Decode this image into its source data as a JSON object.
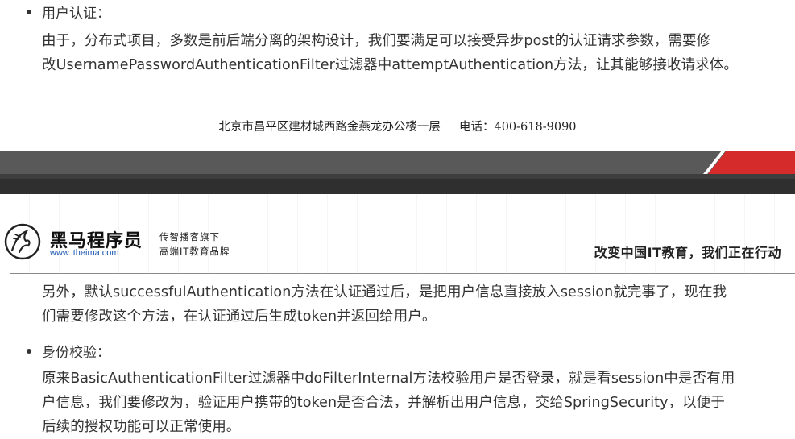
{
  "section_auth": {
    "bullet": "用户认证：",
    "para_line1": "由于，分布式项目，多数是前后端分离的架构设计，我们要满足可以接受异步post的认证请求参数，需要修",
    "para_line2": "改UsernamePasswordAuthenticationFilter过滤器中attemptAuthentication方法，让其能够接收请求体。"
  },
  "footer": {
    "address": "北京市昌平区建材城西路金燕龙办公楼一层     电话：400-618-9090"
  },
  "header": {
    "logo_name": "黑马程序员",
    "logo_url": "www.itheima.com",
    "logo_sub1": "传智播客旗下",
    "logo_sub2": "高端IT教育品牌",
    "slogan": "改变中国IT教育，我们正在行动"
  },
  "section_success": {
    "para_line1": "另外，默认successfulAuthentication方法在认证通过后，是把用户信息直接放入session就完事了，现在我",
    "para_line2": "们需要修改这个方法，在认证通过后生成token并返回给用户。"
  },
  "section_verify": {
    "bullet": "身份校验：",
    "para_line1": "原来BasicAuthenticationFilter过滤器中doFilterInternal方法校验用户是否登录，就是看session中是否有用",
    "para_line2": "户信息，我们要修改为，验证用户携带的token是否合法，并解析出用户信息，交给SpringSecurity，以便于",
    "para_line3": "后续的授权功能可以正常使用。"
  },
  "colors": {
    "band_dark": "#595959",
    "accent_red": "#d62b2b",
    "logo_url_blue": "#1a56b0"
  }
}
